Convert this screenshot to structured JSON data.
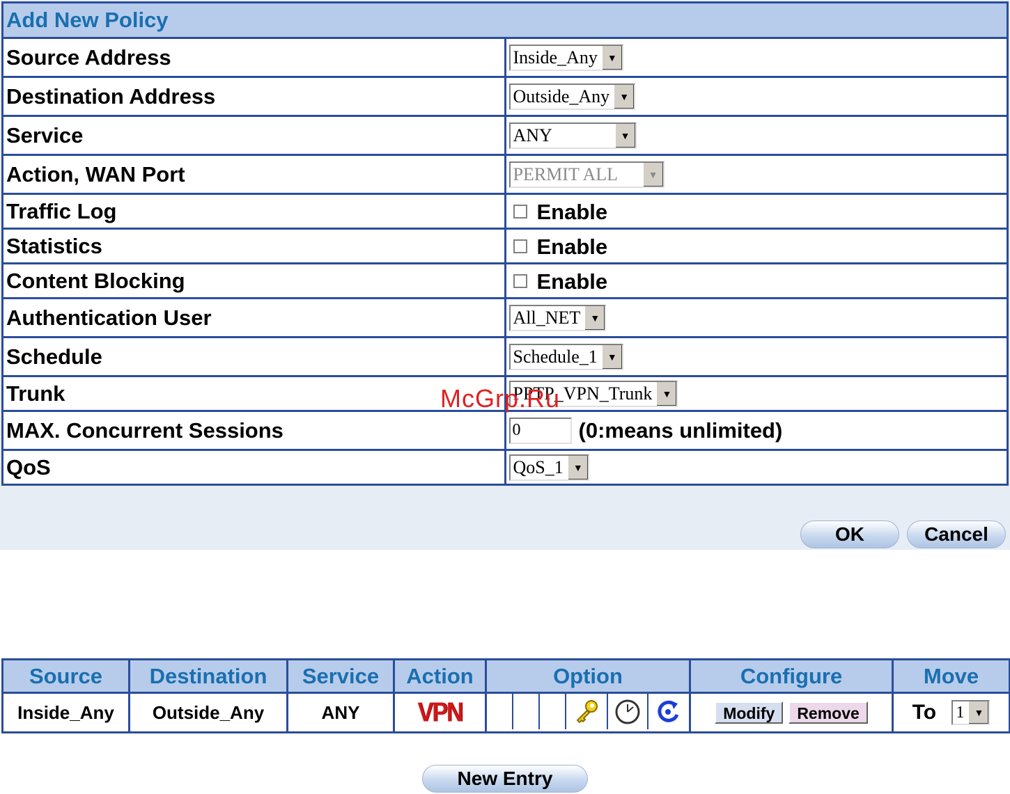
{
  "form": {
    "title": "Add New Policy",
    "rows": [
      {
        "label": "Source Address",
        "value": "Inside_Any"
      },
      {
        "label": "Destination Address",
        "value": "Outside_Any"
      },
      {
        "label": "Service",
        "value": "ANY"
      },
      {
        "label": "Action, WAN Port",
        "value": "PERMIT ALL"
      },
      {
        "label": "Traffic Log",
        "checkbox_label": "Enable",
        "checked": false
      },
      {
        "label": "Statistics",
        "checkbox_label": "Enable",
        "checked": false
      },
      {
        "label": "Content Blocking",
        "checkbox_label": "Enable",
        "checked": false
      },
      {
        "label": "Authentication User",
        "value": "All_NET"
      },
      {
        "label": "Schedule",
        "value": "Schedule_1"
      },
      {
        "label": "Trunk",
        "value": "PPTP_VPN_Trunk"
      },
      {
        "label": "MAX. Concurrent Sessions",
        "value": "0",
        "hint": "(0:means unlimited)"
      },
      {
        "label": "QoS",
        "value": "QoS_1"
      }
    ],
    "ok_label": "OK",
    "cancel_label": "Cancel"
  },
  "watermark": "McGrp.Ru",
  "list": {
    "headers": [
      "Source",
      "Destination",
      "Service",
      "Action",
      "Option",
      "Configure",
      "Move"
    ],
    "row": {
      "source": "Inside_Any",
      "destination": "Outside_Any",
      "service": "ANY",
      "action_icon_text": "VPN",
      "modify_label": "Modify",
      "remove_label": "Remove",
      "move_prefix": "To",
      "move_value": "1"
    },
    "option_icons": [
      "key-icon",
      "clock-icon",
      "refresh-icon"
    ]
  },
  "new_entry_label": "New Entry",
  "colors": {
    "header_bg": "#b7cceb",
    "header_text": "#1a6fb0",
    "border": "#2a4d9b",
    "vpn_red": "#d01818"
  }
}
